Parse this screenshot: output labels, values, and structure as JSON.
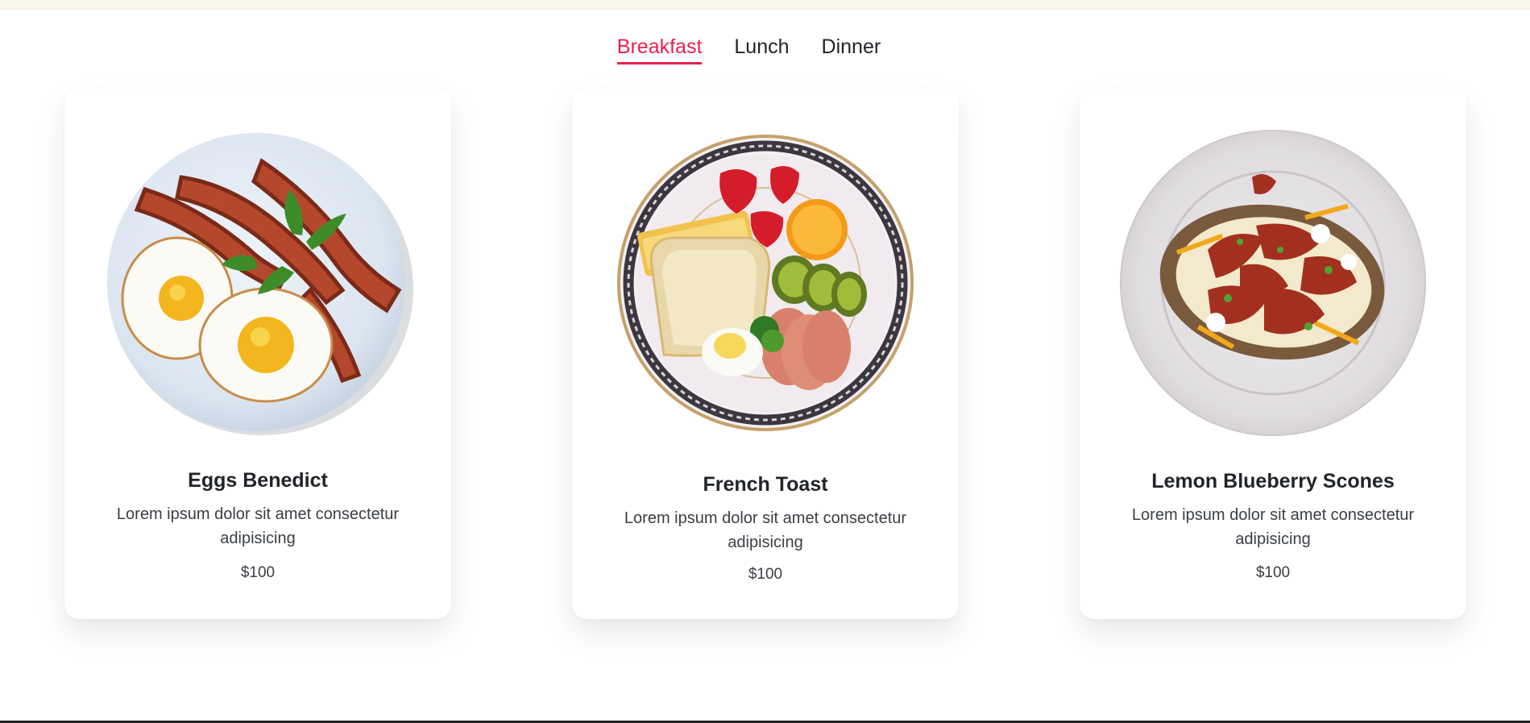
{
  "tabs": [
    {
      "label": "Breakfast",
      "active": true
    },
    {
      "label": "Lunch",
      "active": false
    },
    {
      "label": "Dinner",
      "active": false
    }
  ],
  "accent_color": "#e9204f",
  "cards": [
    {
      "title": "Eggs Benedict",
      "description": "Lorem ipsum dolor sit amet consectetur adipisicing",
      "price": "$100",
      "image": "eggs-bacon-plate"
    },
    {
      "title": "French Toast",
      "description": "Lorem ipsum dolor sit amet consectetur adipisicing",
      "price": "$100",
      "image": "fruit-toast-plate"
    },
    {
      "title": "Lemon Blueberry Scones",
      "description": "Lorem ipsum dolor sit amet consectetur adipisicing",
      "price": "$100",
      "image": "loaded-potato-plate"
    }
  ]
}
